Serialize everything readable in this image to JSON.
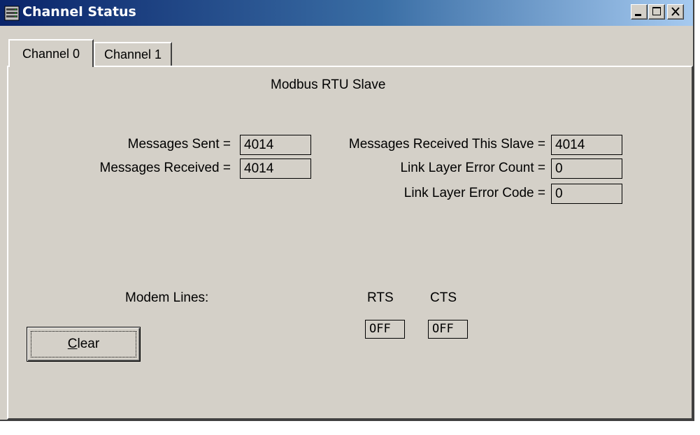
{
  "window": {
    "title": "Channel Status",
    "icon": "network-device-icon"
  },
  "caption_buttons": [
    {
      "name": "minimize-button",
      "icon": "minimize-icon"
    },
    {
      "name": "maximize-button",
      "icon": "maximize-icon"
    },
    {
      "name": "close-button",
      "icon": "close-icon"
    }
  ],
  "tabs": [
    {
      "label": "Channel 0",
      "selected": true
    },
    {
      "label": "Channel 1",
      "selected": false
    }
  ],
  "panel": {
    "heading": "Modbus RTU Slave",
    "messages_sent_label": "Messages Sent =",
    "messages_sent_value": "4014",
    "messages_received_label": "Messages Received =",
    "messages_received_value": "4014",
    "received_this_slave_label": "Messages Received This Slave =",
    "received_this_slave_value": "4014",
    "link_error_count_label": "Link Layer Error Count =",
    "link_error_count_value": "0",
    "link_error_code_label": "Link Layer Error Code =",
    "link_error_code_value": "0",
    "modem_lines_label": "Modem Lines:",
    "rts_label": "RTS",
    "rts_value": "OFF",
    "cts_label": "CTS",
    "cts_value": "OFF",
    "clear_button_mnemonic": "C",
    "clear_button_rest": "lear"
  },
  "colors": {
    "face": "#d4d0c8",
    "title_start": "#0a246a",
    "title_end": "#a6caf0"
  }
}
